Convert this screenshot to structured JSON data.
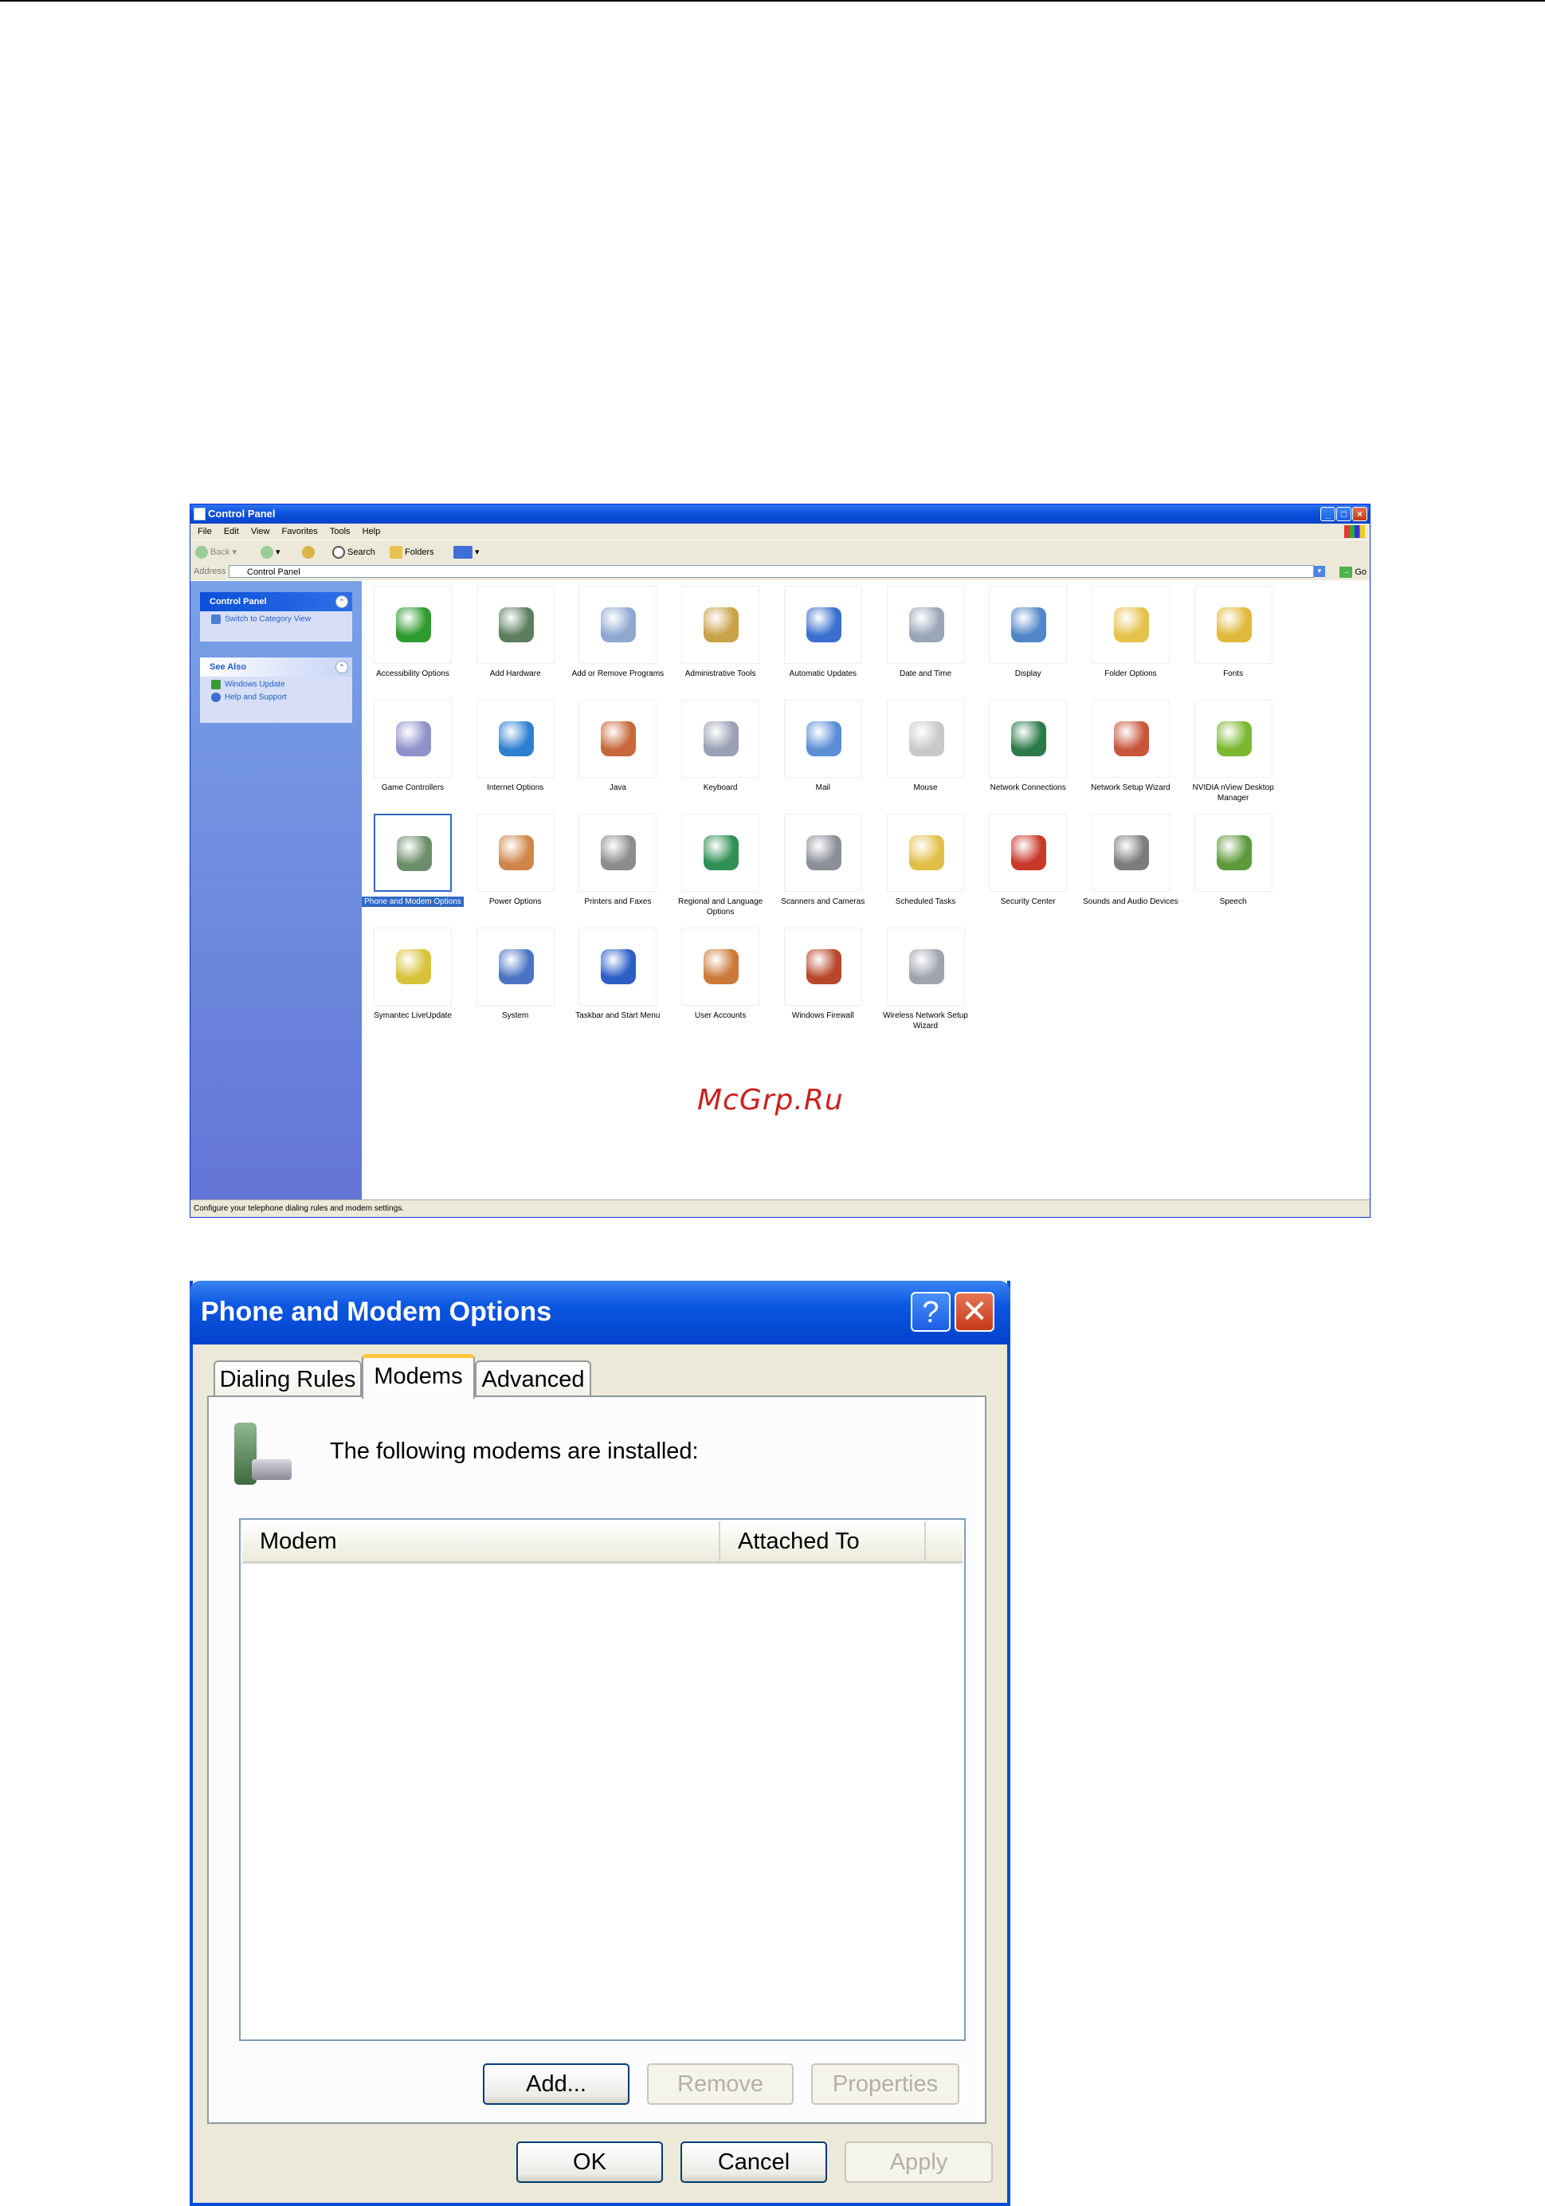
{
  "control_panel": {
    "title": "Control Panel",
    "menu": [
      "File",
      "Edit",
      "View",
      "Favorites",
      "Tools",
      "Help"
    ],
    "toolbar": {
      "back": "Back",
      "search": "Search",
      "folders": "Folders"
    },
    "address": {
      "label": "Address",
      "value": "Control Panel",
      "go": "Go"
    },
    "sidebar": {
      "panel_title": "Control Panel",
      "switch_view": "Switch to Category View",
      "see_also_title": "See Also",
      "see_also_items": [
        "Windows Update",
        "Help and Support"
      ]
    },
    "icons": [
      {
        "label": "Accessibility Options",
        "color": "#2e9b2e"
      },
      {
        "label": "Add Hardware",
        "color": "#5d7d5d"
      },
      {
        "label": "Add or Remove Programs",
        "color": "#8fa8d0"
      },
      {
        "label": "Administrative Tools",
        "color": "#c9a24a"
      },
      {
        "label": "Automatic Updates",
        "color": "#3a6fd0"
      },
      {
        "label": "Date and Time",
        "color": "#9aa6b8"
      },
      {
        "label": "Display",
        "color": "#4f86c7"
      },
      {
        "label": "Folder Options",
        "color": "#e6c14c"
      },
      {
        "label": "Fonts",
        "color": "#e0b83a"
      },
      {
        "label": "Game Controllers",
        "color": "#8f92c9"
      },
      {
        "label": "Internet Options",
        "color": "#2f7fd1"
      },
      {
        "label": "Java",
        "color": "#c7673a"
      },
      {
        "label": "Keyboard",
        "color": "#9a9fb4"
      },
      {
        "label": "Mail",
        "color": "#5b8ed6"
      },
      {
        "label": "Mouse",
        "color": "#c8c8c8"
      },
      {
        "label": "Network Connections",
        "color": "#2c7a49"
      },
      {
        "label": "Network Setup Wizard",
        "color": "#c8553a"
      },
      {
        "label": "NVIDIA nView Desktop Manager",
        "color": "#7ab82e"
      },
      {
        "label": "Phone and Modem Options",
        "color": "#6b8e6b",
        "selected": true
      },
      {
        "label": "Power Options",
        "color": "#d0864a"
      },
      {
        "label": "Printers and Faxes",
        "color": "#8c8c8c"
      },
      {
        "label": "Regional and Language Options",
        "color": "#2f8f55"
      },
      {
        "label": "Scanners and Cameras",
        "color": "#8a8f98"
      },
      {
        "label": "Scheduled Tasks",
        "color": "#e3bf4a"
      },
      {
        "label": "Security Center",
        "color": "#c9382b"
      },
      {
        "label": "Sounds and Audio Devices",
        "color": "#7c7c7c"
      },
      {
        "label": "Speech",
        "color": "#5e9a3c"
      },
      {
        "label": "Symantec LiveUpdate",
        "color": "#d8c23a"
      },
      {
        "label": "System",
        "color": "#4b74c2"
      },
      {
        "label": "Taskbar and Start Menu",
        "color": "#2d5ec6"
      },
      {
        "label": "User Accounts",
        "color": "#cc7a3a"
      },
      {
        "label": "Windows Firewall",
        "color": "#b8472c"
      },
      {
        "label": "Wireless Network Setup Wizard",
        "color": "#9fa4ad"
      }
    ],
    "status_text": "Configure your telephone dialing rules and modem settings."
  },
  "watermark": "McGrp.Ru",
  "dialog": {
    "title": "Phone and Modem Options",
    "help_glyph": "?",
    "close_glyph": "✕",
    "tabs": [
      "Dialing Rules",
      "Modems",
      "Advanced"
    ],
    "active_tab": "Modems",
    "intro": "The following modems are  installed:",
    "columns": [
      "Modem",
      "Attached To"
    ],
    "rows": [],
    "panel_buttons": {
      "add": "Add...",
      "remove": "Remove",
      "properties": "Properties"
    },
    "footer_buttons": {
      "ok": "OK",
      "cancel": "Cancel",
      "apply": "Apply"
    }
  }
}
